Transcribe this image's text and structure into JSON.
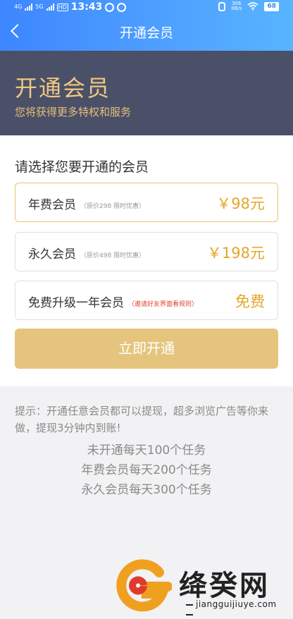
{
  "status_bar": {
    "left_signal_1": "4G",
    "left_signal_2": "5G",
    "hd_badge": "HD",
    "time": "13:43",
    "net_speed_value": "306",
    "net_speed_unit": "KB/s",
    "battery": "68"
  },
  "nav": {
    "title": "开通会员"
  },
  "banner": {
    "title": "开通会员",
    "subtitle": "您将获得更多特权和服务"
  },
  "section_title": "请选择您要开通的会员",
  "plans": [
    {
      "name": "年费会员",
      "note": "（原价298 限时优惠）",
      "price": "￥98元",
      "selected": true
    },
    {
      "name": "永久会员",
      "note": "（原价498 限时优惠）",
      "price": "￥198元",
      "selected": false
    },
    {
      "name": "免费升级一年会员",
      "note": "（邀请好友界面看规则）",
      "price": "免费",
      "selected": false
    }
  ],
  "open_button": "立即开通",
  "tips": {
    "text": "提示：开通任意会员都可以提现，超多浏览广告等你来做，提现3分钟内到账!",
    "lines": [
      "未开通每天100个任务",
      "年费会员每天200个任务",
      "永久会员每天300个任务"
    ]
  },
  "watermark": {
    "name": "绛癸网",
    "url": "jiangguijiuye.com"
  },
  "colors": {
    "header_gradient_start": "#3d86ff",
    "banner_bg": "#4a5068",
    "gold": "#e6a52a",
    "button_bg": "#e5c57e"
  }
}
